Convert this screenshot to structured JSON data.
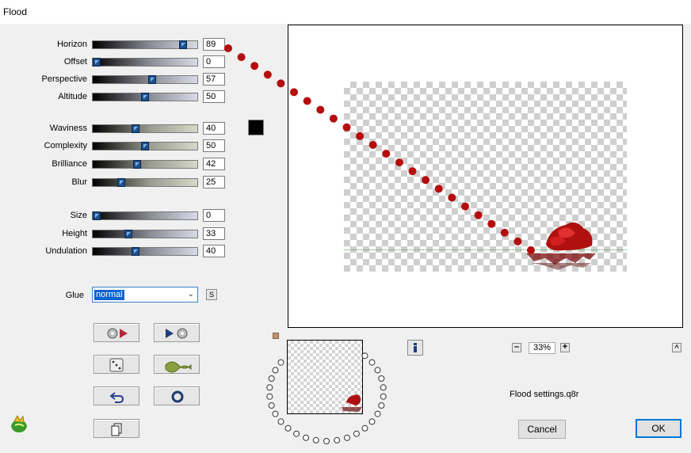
{
  "window": {
    "title": "Flood"
  },
  "sliders": [
    {
      "label": "Horizon",
      "value": "89",
      "fraction": 0.89
    },
    {
      "label": "Offset",
      "value": "0",
      "fraction": 0.0
    },
    {
      "label": "Perspective",
      "value": "57",
      "fraction": 0.57
    },
    {
      "label": "Altitude",
      "value": "50",
      "fraction": 0.5
    },
    {
      "label": "Waviness",
      "value": "40",
      "fraction": 0.4
    },
    {
      "label": "Complexity",
      "value": "50",
      "fraction": 0.5
    },
    {
      "label": "Brilliance",
      "value": "42",
      "fraction": 0.42
    },
    {
      "label": "Blur",
      "value": "25",
      "fraction": 0.25
    },
    {
      "label": "Size",
      "value": "0",
      "fraction": 0.0
    },
    {
      "label": "Height",
      "value": "33",
      "fraction": 0.33
    },
    {
      "label": "Undulation",
      "value": "40",
      "fraction": 0.4
    }
  ],
  "color_swatch": "#000000",
  "glue": {
    "label": "Glue",
    "value": "normal"
  },
  "zoom": {
    "value": "33%"
  },
  "settings_file": "Flood settings.q8r",
  "buttons": {
    "cancel": "Cancel",
    "ok": "OK"
  },
  "icons": [
    "reset-arrow-icon",
    "forward-arrow-icon",
    "dice-icon",
    "wave-icon",
    "undo-icon",
    "ring-icon",
    "copy-icon",
    "info-icon",
    "zoom-out-icon",
    "zoom-in-icon",
    "collapse-icon",
    "logo-icon"
  ]
}
